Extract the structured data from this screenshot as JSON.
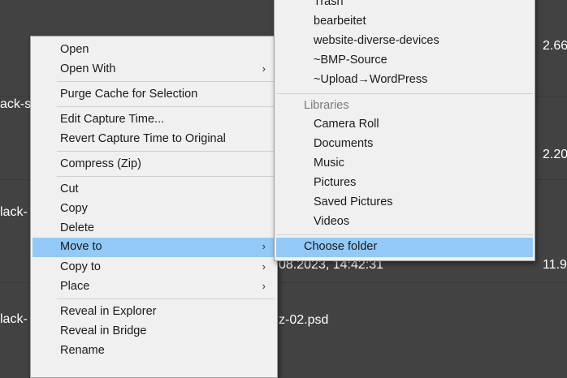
{
  "background": {
    "left_snippets": [
      "ack-s",
      "lack-",
      "lack-"
    ],
    "right_numbers": [
      "2.66",
      "2.20",
      "11.9"
    ],
    "date_text": "08.2023, 14:42:31",
    "file_fragment": "z-02.psd"
  },
  "context_menu": {
    "items": [
      {
        "label": "Open"
      },
      {
        "label": "Open With",
        "submenu": true
      },
      {
        "label": "Purge Cache for Selection"
      },
      {
        "label": "Edit Capture Time..."
      },
      {
        "label": "Revert Capture Time to Original"
      },
      {
        "label": "Compress (Zip)"
      },
      {
        "label": "Cut"
      },
      {
        "label": "Copy"
      },
      {
        "label": "Delete"
      },
      {
        "label": "Move to",
        "submenu": true,
        "highlighted": true
      },
      {
        "label": "Copy to",
        "submenu": true
      },
      {
        "label": "Place",
        "submenu": true
      },
      {
        "label": "Reveal in Explorer"
      },
      {
        "label": "Reveal in Bridge"
      },
      {
        "label": "Rename"
      }
    ]
  },
  "move_to_submenu": {
    "recent": [
      "Trash",
      "bearbeitet",
      "website-diverse-devices",
      "~BMP-Source",
      "~Upload→WordPress"
    ],
    "libraries_header": "Libraries",
    "libraries": [
      "Camera Roll",
      "Documents",
      "Music",
      "Pictures",
      "Saved Pictures",
      "Videos"
    ],
    "choose_folder": "Choose folder"
  },
  "icons": {
    "submenu_arrow": "chevron-right-icon"
  },
  "colors": {
    "background": "#424242",
    "menu_bg": "#f0f0f0",
    "highlight": "#92c9f6",
    "menu_text": "#1a1a1a",
    "header_text": "#7a7a7a"
  }
}
